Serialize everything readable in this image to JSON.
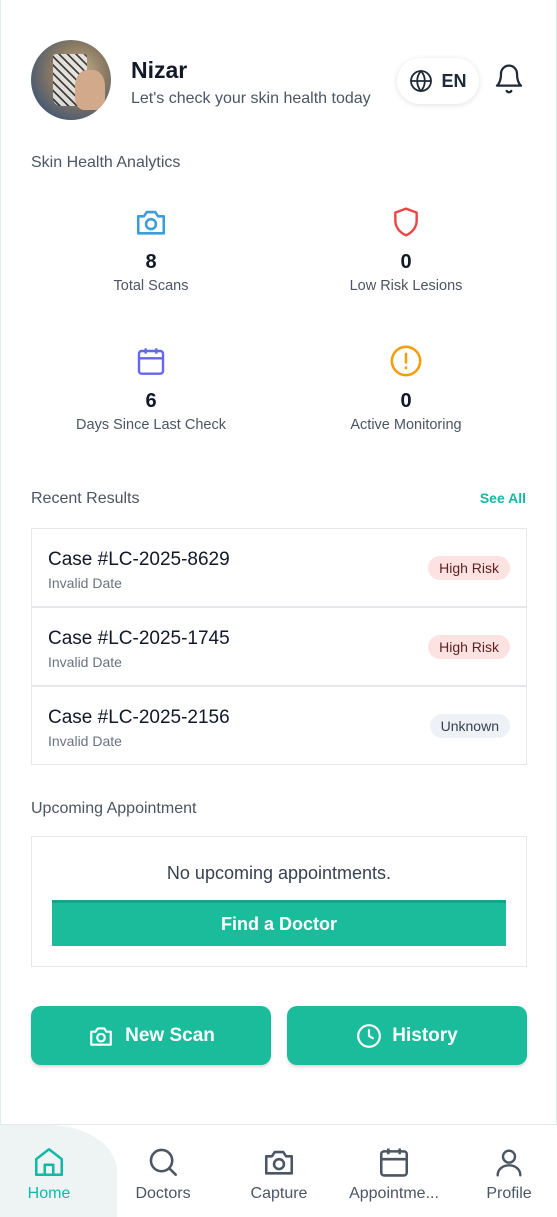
{
  "user": {
    "name": "Nizar",
    "subtitle": "Let's check your skin health today"
  },
  "header": {
    "language": "EN"
  },
  "analytics": {
    "title": "Skin Health Analytics",
    "stats": [
      {
        "value": "8",
        "label": "Total Scans",
        "icon": "camera-icon",
        "color": "#3b9ed8"
      },
      {
        "value": "0",
        "label": "Low Risk Lesions",
        "icon": "shield-icon",
        "color": "#ef4444"
      },
      {
        "value": "6",
        "label": "Days Since Last Check",
        "icon": "calendar-icon",
        "color": "#6366f1"
      },
      {
        "value": "0",
        "label": "Active Monitoring",
        "icon": "alert-icon",
        "color": "#f59e0b"
      }
    ]
  },
  "recent": {
    "title": "Recent Results",
    "see_all": "See All",
    "items": [
      {
        "case": "Case #LC-2025-8629",
        "date": "Invalid Date",
        "badge": "High Risk"
      },
      {
        "case": "Case #LC-2025-1745",
        "date": "Invalid Date",
        "badge": "High Risk"
      },
      {
        "case": "Case #LC-2025-2156",
        "date": "Invalid Date",
        "badge": "Unknown"
      }
    ]
  },
  "appointment": {
    "title": "Upcoming Appointment",
    "empty": "No upcoming appointments.",
    "find_label": "Find a Doctor"
  },
  "actions": {
    "new_scan": "New Scan",
    "history": "History"
  },
  "nav": {
    "items": [
      {
        "label": "Home"
      },
      {
        "label": "Doctors"
      },
      {
        "label": "Capture"
      },
      {
        "label": "Appointme..."
      },
      {
        "label": "Profile"
      }
    ]
  },
  "colors": {
    "accent": "#1abc9c",
    "accent_text": "#14b8a6"
  }
}
